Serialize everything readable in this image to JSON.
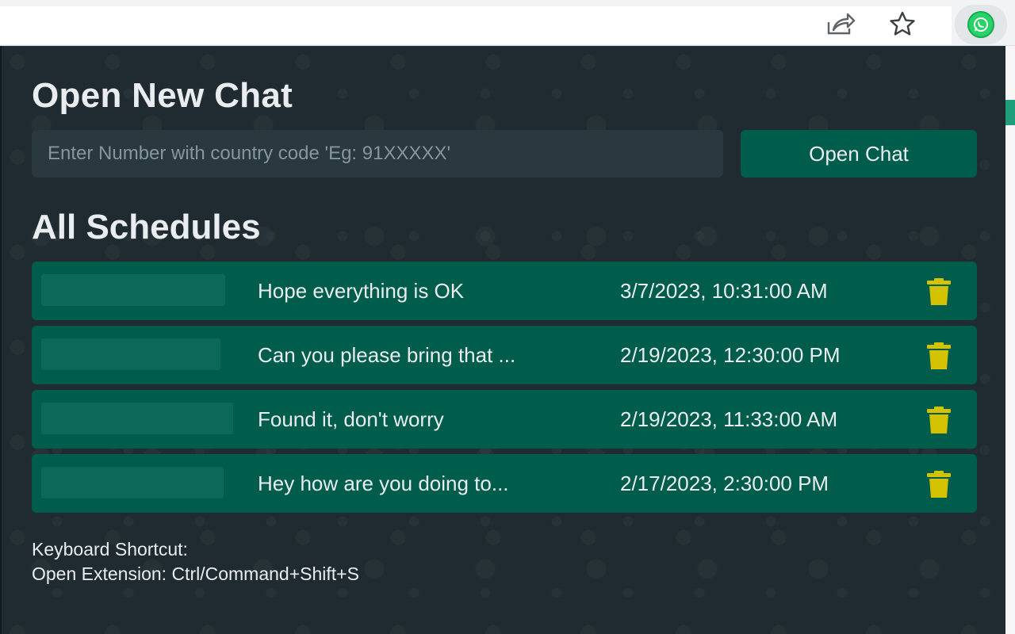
{
  "toolbar": {
    "icons": [
      "share-icon",
      "star-icon",
      "whatsapp-extension-icon"
    ],
    "extension_color": "#25d366"
  },
  "popup": {
    "title": "Open New Chat",
    "number_input": {
      "value": "",
      "placeholder": "Enter Number with country code 'Eg: 91XXXXX'"
    },
    "open_chat_label": "Open Chat",
    "schedules_title": "All Schedules",
    "schedules": [
      {
        "message": "Hope everything is OK",
        "time": "3/7/2023, 10:31:00 AM"
      },
      {
        "message": "Can you please bring that ...",
        "time": "2/19/2023, 12:30:00 PM"
      },
      {
        "message": "Found it, don't worry",
        "time": "2/19/2023, 11:33:00 AM"
      },
      {
        "message": "Hey how are you doing to...",
        "time": "2/17/2023, 2:30:00 PM"
      }
    ],
    "shortcut_heading": "Keyboard Shortcut:",
    "shortcut_text": "Open Extension: Ctrl/Command+Shift+S"
  },
  "colors": {
    "background": "#1f2b30",
    "accent": "#005c4b",
    "input_bg": "#2a3840",
    "delete_icon": "#d4c200",
    "text": "#e9edef"
  }
}
